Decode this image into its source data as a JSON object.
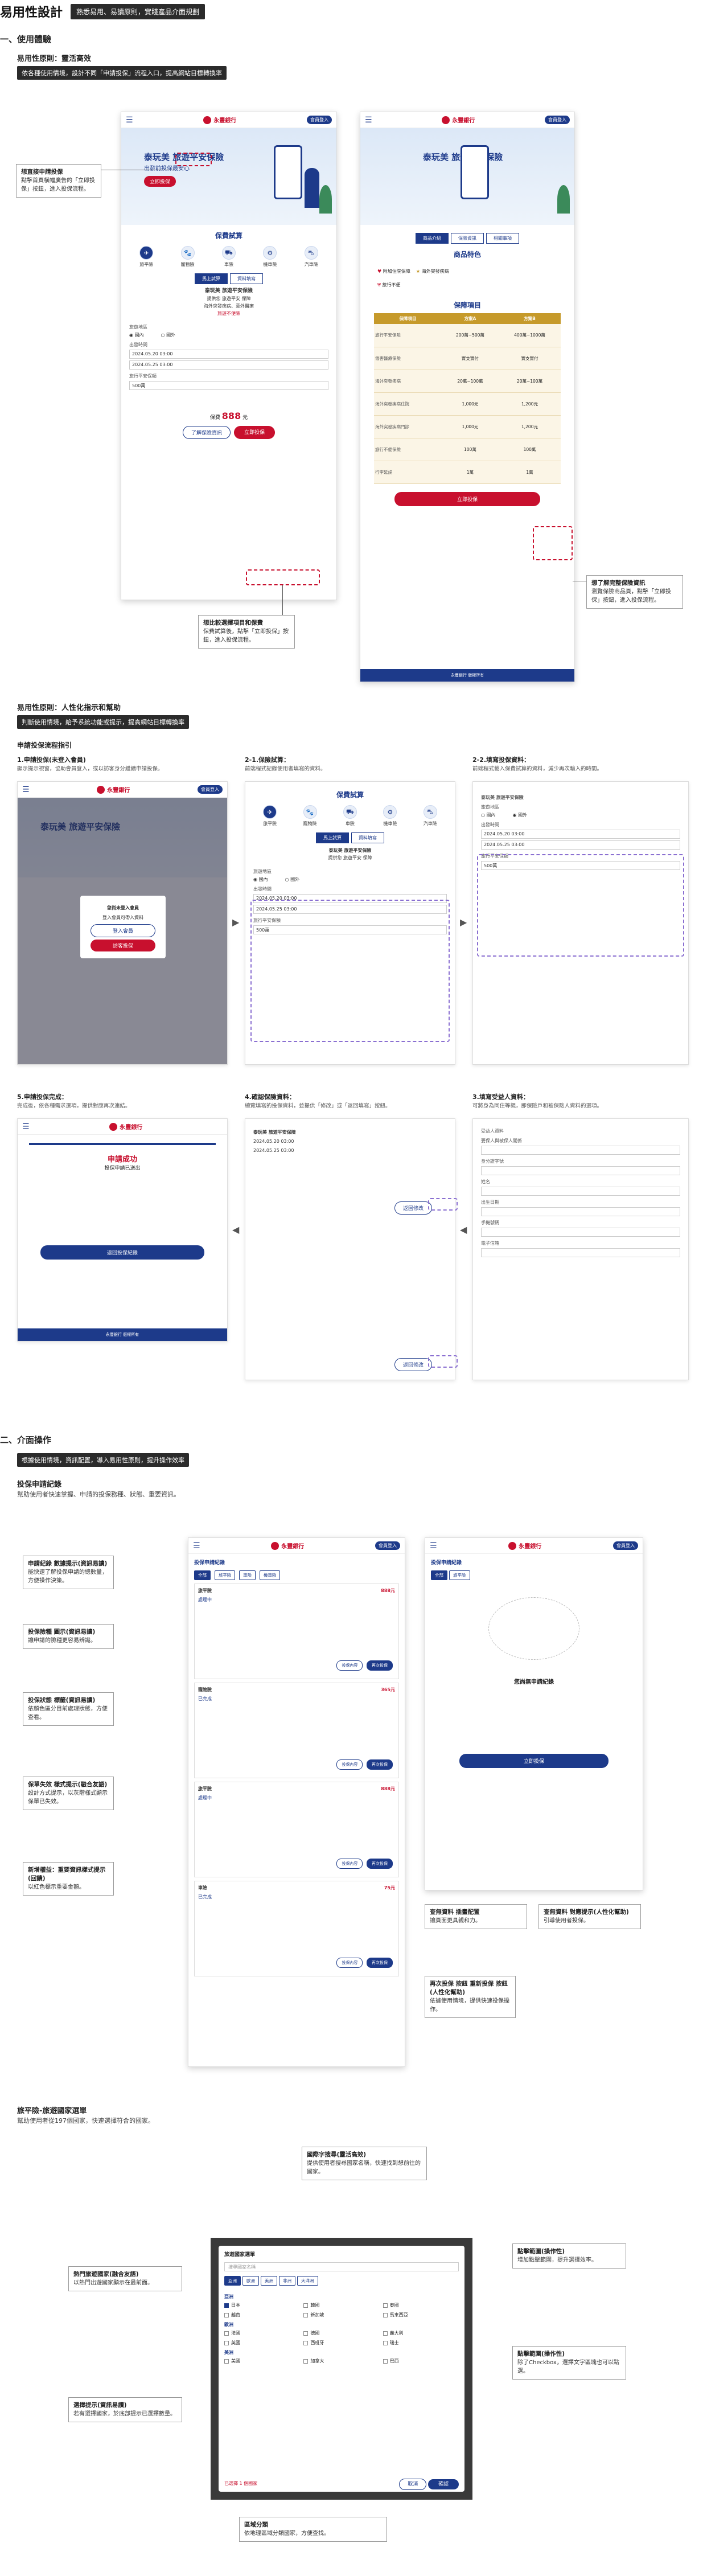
{
  "header": {
    "title": "易用性設計",
    "tag": "熟悉易用、易讀原則，實踐產品介面規劃"
  },
  "sec1": {
    "title": "一、使用體驗",
    "sub": "易用性原則：靈活高效",
    "tag": "依各種使用情境，設計不同「申請投保」流程入口，提高網站目標轉換率",
    "phone1": {
      "bank": "永豐銀行",
      "login": "會員登入",
      "hero_title": "泰玩美 旅遊平安保險",
      "hero_sub": "出發前投保最安心",
      "hero_btn": "立即投保",
      "calc_title": "保費試算",
      "icons": [
        "旅平險",
        "寵物險",
        "車險",
        "機車險",
        "汽車險"
      ],
      "pills": [
        "馬上試算",
        "資料填寫"
      ],
      "plan_title": "泰玩美 旅遊平安保險",
      "plan_l1": "提供您 旅遊平安 保障",
      "plan_l2": "海外突發疾病、意外醫療",
      "plan_red": "旅遊不便險",
      "dest_lbl": "旅遊地區",
      "dest_opts": [
        "國內",
        "國外"
      ],
      "date_lbl": "出發時間",
      "date1": "2024.05.20 03:00",
      "date2": "2024.05.25 03:00",
      "amt_lbl": "旅行平安保額",
      "amt_val": "500萬",
      "price_pre": "保費",
      "price": "888",
      "price_unit": "元",
      "btn_more": "了解保險資訊",
      "btn_apply": "立即投保"
    },
    "phone2": {
      "bank": "永豐銀行",
      "login": "會員登入",
      "hero_title": "泰玩美 旅遊平安保險",
      "tabs": [
        "商品介紹",
        "保險資訊",
        "相關事項"
      ],
      "feat_title": "商品特色",
      "feat": [
        "附加住院保障",
        "海外突發疾病",
        "旅行不便"
      ],
      "tbl_title": "保障項目",
      "tbl_head": [
        "保障項目",
        "方案A",
        "方案B"
      ],
      "tbl_rows": [
        [
          "旅行平安保險",
          "200萬~500萬",
          "400萬~1000萬"
        ],
        [
          "傷害醫療保險",
          "實支實付",
          "實支實付"
        ],
        [
          "海外突發疾病",
          "20萬~100萬",
          "20萬~100萬"
        ],
        [
          "海外突發疾病住院",
          "1,000元",
          "1,200元"
        ],
        [
          "海外突發疾病門診",
          "1,000元",
          "1,200元"
        ],
        [
          "旅行不便保險",
          "100萬",
          "100萬"
        ],
        [
          "行李延誤",
          "1萬",
          "1萬"
        ]
      ],
      "trial_btn": "保費試算",
      "apply_btn": "立即投保",
      "foot": "永豐銀行 版權所有"
    },
    "callouts": {
      "c1_t": "想直接申請投保",
      "c1_b": "點擊首頁横幅廣告的「立即投保」按鈕，進入投保流程。",
      "c2_t": "想比較選擇項目和保費",
      "c2_b": "保費試算後，點擊「立即投保」按鈕，進入投保流程。",
      "c3_t": "想了解完整保險資訊",
      "c3_b": "瀏覽保險商品頁，點擊「立即投保」按鈕，進入投保流程。"
    }
  },
  "sec2": {
    "sub": "易用性原則：人性化指示和幫助",
    "tag": "判斷使用情境，給予系統功能或提示，提高網站目標轉換率",
    "flow_title": "申請投保流程指引",
    "steps": [
      {
        "h": "1.申請投保(未登入會員)",
        "d": "顯示提示視窗，協助會員登入，或以訪客身分繼續申請投保。"
      },
      {
        "h": "2-1.保險試算：",
        "d": "前端程式記錄使用者填寫的資料。"
      },
      {
        "h": "2-2.填寫投保資料：",
        "d": "前端程式載入保費試算的資料，減少再次輸入的時間。"
      },
      {
        "h": "5.申請投保完成：",
        "d": "完成後，依各種需求選項，提供對應再次連結。"
      },
      {
        "h": "4.確認保險資料：",
        "d": "總覽填寫的投保資料，並提供「修改」或「返回填寫」按鈕。"
      },
      {
        "h": "3.填寫受益人資料：",
        "d": "可將身為同住等親，即保險戶和被保險人資料的選項。"
      }
    ],
    "modal": {
      "title": "您尚未登入會員",
      "body": "登入會員可帶入資料",
      "b1": "登入會員",
      "b2": "訪客投保"
    },
    "done": {
      "title": "申請成功",
      "sub": "投保申請已送出",
      "btn": "返回投保紀錄"
    },
    "conf_btn": "返回修改",
    "form3": [
      "受益人資料",
      "要保人與被保人關係",
      "身分證字號",
      "姓名",
      "出生日期",
      "手機號碼",
      "電子信箱"
    ]
  },
  "sec3": {
    "title": "二、介面操作",
    "tag": "根據使用情境，資訊配置，導入易用性原則，提升操作效率",
    "sub": "投保申請紀錄",
    "desc": "幫助使用者快速掌握、申請的投保務種、狀態、重要資訊。",
    "list_title": "投保申請紀錄",
    "filters": [
      "全部",
      "旅平險",
      "車險",
      "機車險"
    ],
    "records": [
      {
        "t": "旅平險",
        "amt": "888元",
        "st": "處理中"
      },
      {
        "t": "寵物險",
        "amt": "365元",
        "st": "已完成"
      },
      {
        "t": "旅平險",
        "amt": "888元",
        "st": "處理中"
      },
      {
        "t": "車險",
        "amt": "75元",
        "st": "已完成"
      }
    ],
    "rec_btn1": "投保內容",
    "rec_btn2": "再次投保",
    "empty_title": "您尚無申請紀錄",
    "empty_btn": "立即投保",
    "callouts": [
      {
        "t": "申請紀錄 數據提示(資訊易讀)",
        "b": "能快速了解投保申請的總數量，方便操作決策。"
      },
      {
        "t": "投保險種 圖示(資訊易讀)",
        "b": "讓申請的險種更容易辨識。"
      },
      {
        "t": "投保狀態 標籤(資訊易讀)",
        "b": "依顏色區分目前處理狀態，方便查看。"
      },
      {
        "t": "保單失效 樣式提示(融合友語)",
        "b": "設計方式提示，以灰階樣式顯示保單已失效。"
      },
      {
        "t": "新增權益：重要資訊樣式提示(回饋)",
        "b": "以紅色標示重要金額。"
      },
      {
        "t": "再次投保 按鈕 重新投保 按鈕(人性化幫助)",
        "b": "依據使用情境，提供快速投保操作。"
      },
      {
        "t": "查無資料 插畫配置",
        "b": "讓頁面更具親和力。"
      },
      {
        "t": "查無資料 對應提示(人性化幫助)",
        "b": "引導使用者投保。"
      }
    ]
  },
  "sec4": {
    "sub": "旅平險-旅遊國家選單",
    "desc": "幫助使用者從197個國家，快速選擇符合的國家。",
    "dlg_title": "旅遊國家選單",
    "search_ph": "搜尋國家名稱",
    "region_chips": [
      "亞洲",
      "歐洲",
      "美洲",
      "非洲",
      "大洋洲"
    ],
    "regions": [
      {
        "name": "亞洲",
        "countries": [
          "日本",
          "韓國",
          "泰國",
          "越南",
          "新加坡",
          "馬來西亞"
        ]
      },
      {
        "name": "歐洲",
        "countries": [
          "法國",
          "德國",
          "義大利",
          "英國",
          "西班牙",
          "瑞士"
        ]
      },
      {
        "name": "美洲",
        "countries": [
          "美國",
          "加拿大",
          "巴西"
        ]
      }
    ],
    "selected": "已選擇 1 個國家",
    "cancel": "取消",
    "ok": "確認",
    "callouts": [
      {
        "t": "國際字搜尋(靈活高效)",
        "b": "提供使用者搜尋國家名稱，快速找到想前往的國家。"
      },
      {
        "t": "熱門旅遊國家(融合友語)",
        "b": "以熱門出遊國家顯示在最前面。"
      },
      {
        "t": "點擊範圍(操作性)",
        "b": "增加點擊範圍，提升選擇效率。"
      },
      {
        "t": "點擊範圍(操作性)",
        "b": "除了Checkbox，選擇文字區塊也可以點選。"
      },
      {
        "t": "選擇提示(資訊易讀)",
        "b": "若有選擇國家，於底部提示已選擇數量。"
      },
      {
        "t": "區域分類",
        "b": "依地理區域分類國家，方便查找。"
      }
    ]
  }
}
